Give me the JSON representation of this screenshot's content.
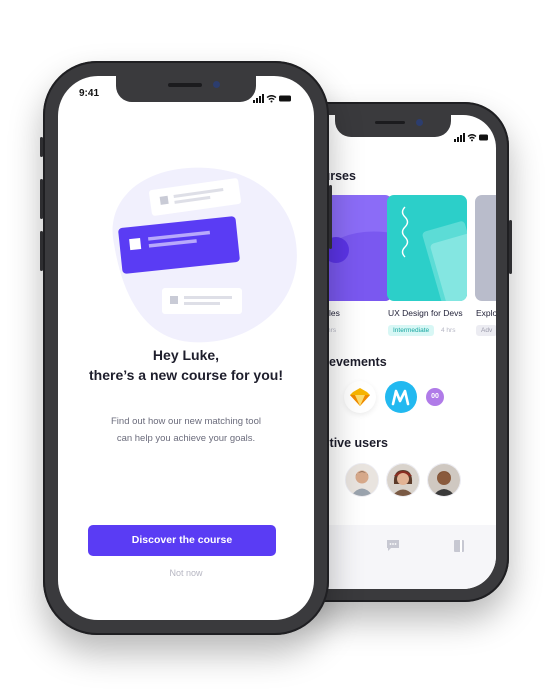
{
  "front_phone": {
    "status_bar": {
      "time": "9:41"
    },
    "prompt": {
      "greeting": "Hey Luke,",
      "headline": "there’s a new course for you!",
      "body_line_1": "Find out how our new matching tool",
      "body_line_2": "can help you achieve your goals."
    },
    "primary_button": "Discover the course",
    "secondary_link": "Not now"
  },
  "back_phone": {
    "courses_title": "courses",
    "courses": [
      {
        "title": "Principles",
        "tag": "",
        "hours": "12 hrs",
        "color": "#8b6cf7"
      },
      {
        "title": "UX Design for Devs",
        "tag": "Intermediate",
        "hours": "4 hrs",
        "color": "#2ccfc9"
      },
      {
        "title": "Explo",
        "tag": "Adv",
        "hours": "",
        "color": "#b9bccb"
      }
    ],
    "achievements_title": "evements",
    "badge_text": "00",
    "users_title": "t active users"
  },
  "colors": {
    "accent": "#5a3cf4",
    "teal": "#2ccfc9",
    "teal_tag_bg": "#d8f7f5",
    "badge_blue": "#22b9f0"
  }
}
